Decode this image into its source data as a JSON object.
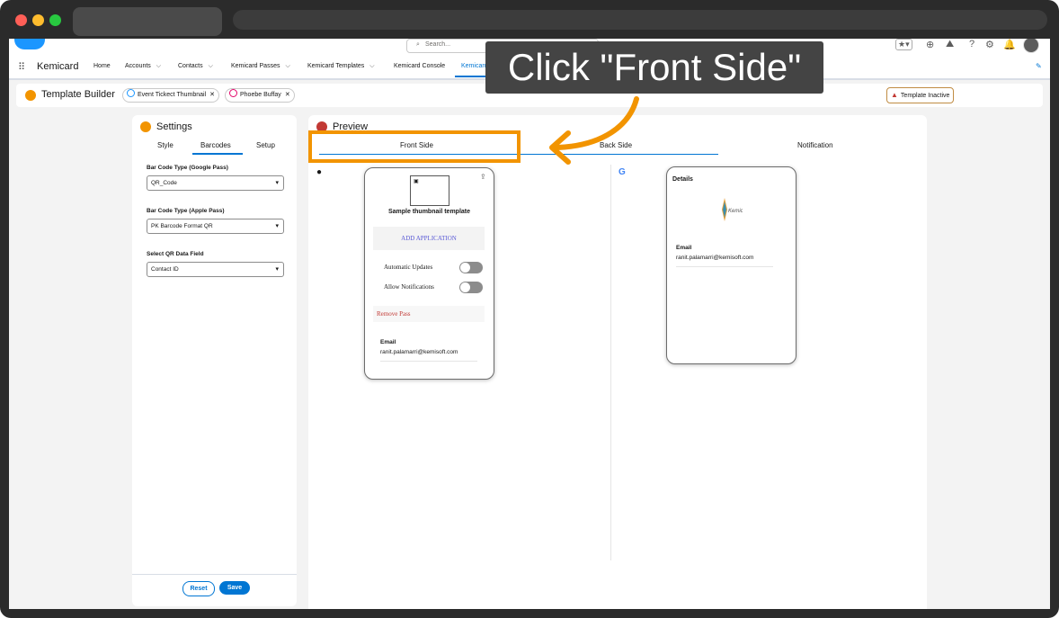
{
  "header": {
    "search_placeholder": "Search..."
  },
  "nav": {
    "app_name": "Kemicard",
    "items": [
      {
        "label": "Home"
      },
      {
        "label": "Accounts"
      },
      {
        "label": "Contacts"
      },
      {
        "label": "Kemicard Passes"
      },
      {
        "label": "Kemicard Templates"
      },
      {
        "label": "Kemicard Console"
      },
      {
        "label": "Kemicard"
      }
    ]
  },
  "page": {
    "title": "Template Builder",
    "pill_template": "Event Tickect Thumbnail",
    "pill_contact": "Phoebe Buffay",
    "status_badge": "Template Inactive"
  },
  "settings": {
    "title": "Settings",
    "tabs": [
      "Style",
      "Barcodes",
      "Setup"
    ],
    "active_tab": "Barcodes",
    "fields": [
      {
        "label": "Bar Code Type (Google Pass)",
        "value": "QR_Code"
      },
      {
        "label": "Bar Code Type (Apple Pass)",
        "value": "PK Barcode Format QR"
      },
      {
        "label": "Select QR Data Field",
        "value": "Contact ID"
      }
    ],
    "reset_label": "Reset",
    "save_label": "Save"
  },
  "preview": {
    "title": "Preview",
    "tabs": [
      "Front Side",
      "Back Side",
      "Notification"
    ],
    "apple_card": {
      "title": "Sample thumbnail template",
      "add_application": "ADD APPLICATION",
      "automatic_updates": "Automatic Updates",
      "allow_notifications": "Allow Notifications",
      "remove_pass": "Remove Pass",
      "email_label": "Email",
      "email_value": "ranit.palamarri@kemisoft.com"
    },
    "google_card": {
      "details": "Details",
      "email_label": "Email",
      "email_value": "ranit.palamarri@kemisoft.com"
    }
  },
  "callout": {
    "text": "Click \"Front Side\"",
    "color": "#f29400"
  }
}
